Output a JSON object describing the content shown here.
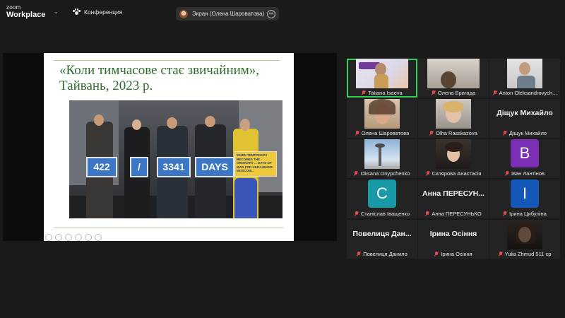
{
  "app": {
    "logo_line1": "zoom",
    "logo_line2": "Workplace"
  },
  "meeting": {
    "title": "Конференция",
    "share_label": "Экран (Олена Шароватова)"
  },
  "slide": {
    "title_line1": "«Коли тимчасове стає звичайним»,",
    "title_line2": "Тайвань, 2023 р.",
    "signs": [
      "422",
      "/",
      "3341",
      "DAYS"
    ],
    "yellow_sign": "WHEN TEMPORARY BECOMES THE ORDINARY ... DAYS OF WAR FOR UKRAINIANS. MOSCOW..."
  },
  "participants": [
    {
      "name": "Tatiana Isaeva",
      "muted": true,
      "type": "video",
      "active": true
    },
    {
      "name": "Олена Бригада",
      "muted": true,
      "type": "video"
    },
    {
      "name": "Anton Oleksandrovych...",
      "muted": true,
      "type": "video"
    },
    {
      "name": "Олена Шароватова",
      "muted": true,
      "type": "video"
    },
    {
      "name": "Olha Rasskazova",
      "muted": true,
      "type": "video"
    },
    {
      "name": "Діщук Михайло",
      "muted": true,
      "type": "name",
      "display": "Діщук Михайло"
    },
    {
      "name": "Oksana Onypchenko",
      "muted": true,
      "type": "video"
    },
    {
      "name": "Склярова Анастасія",
      "muted": true,
      "type": "video"
    },
    {
      "name": "Іван Лантінов",
      "muted": true,
      "type": "letter",
      "letter": "В",
      "color": "#7b2fb5"
    },
    {
      "name": "Станіслав Іващенко",
      "muted": true,
      "type": "letter",
      "letter": "С",
      "color": "#1a9aa8"
    },
    {
      "name": "Анна ПЕРЕСУНЬКО",
      "muted": true,
      "type": "name",
      "display": "Анна ПЕРЕСУН..."
    },
    {
      "name": "Ірина Цибуліна",
      "muted": true,
      "type": "letter",
      "letter": "І",
      "color": "#1559b8"
    },
    {
      "name": "Повелиця Данило",
      "muted": true,
      "type": "name",
      "display": "Повелиця Дан..."
    },
    {
      "name": "Ірина Осіння",
      "muted": true,
      "type": "name",
      "display": "Ірина Осіння"
    },
    {
      "name": "Yulia Zhmud 511 ср",
      "muted": true,
      "type": "video"
    }
  ]
}
